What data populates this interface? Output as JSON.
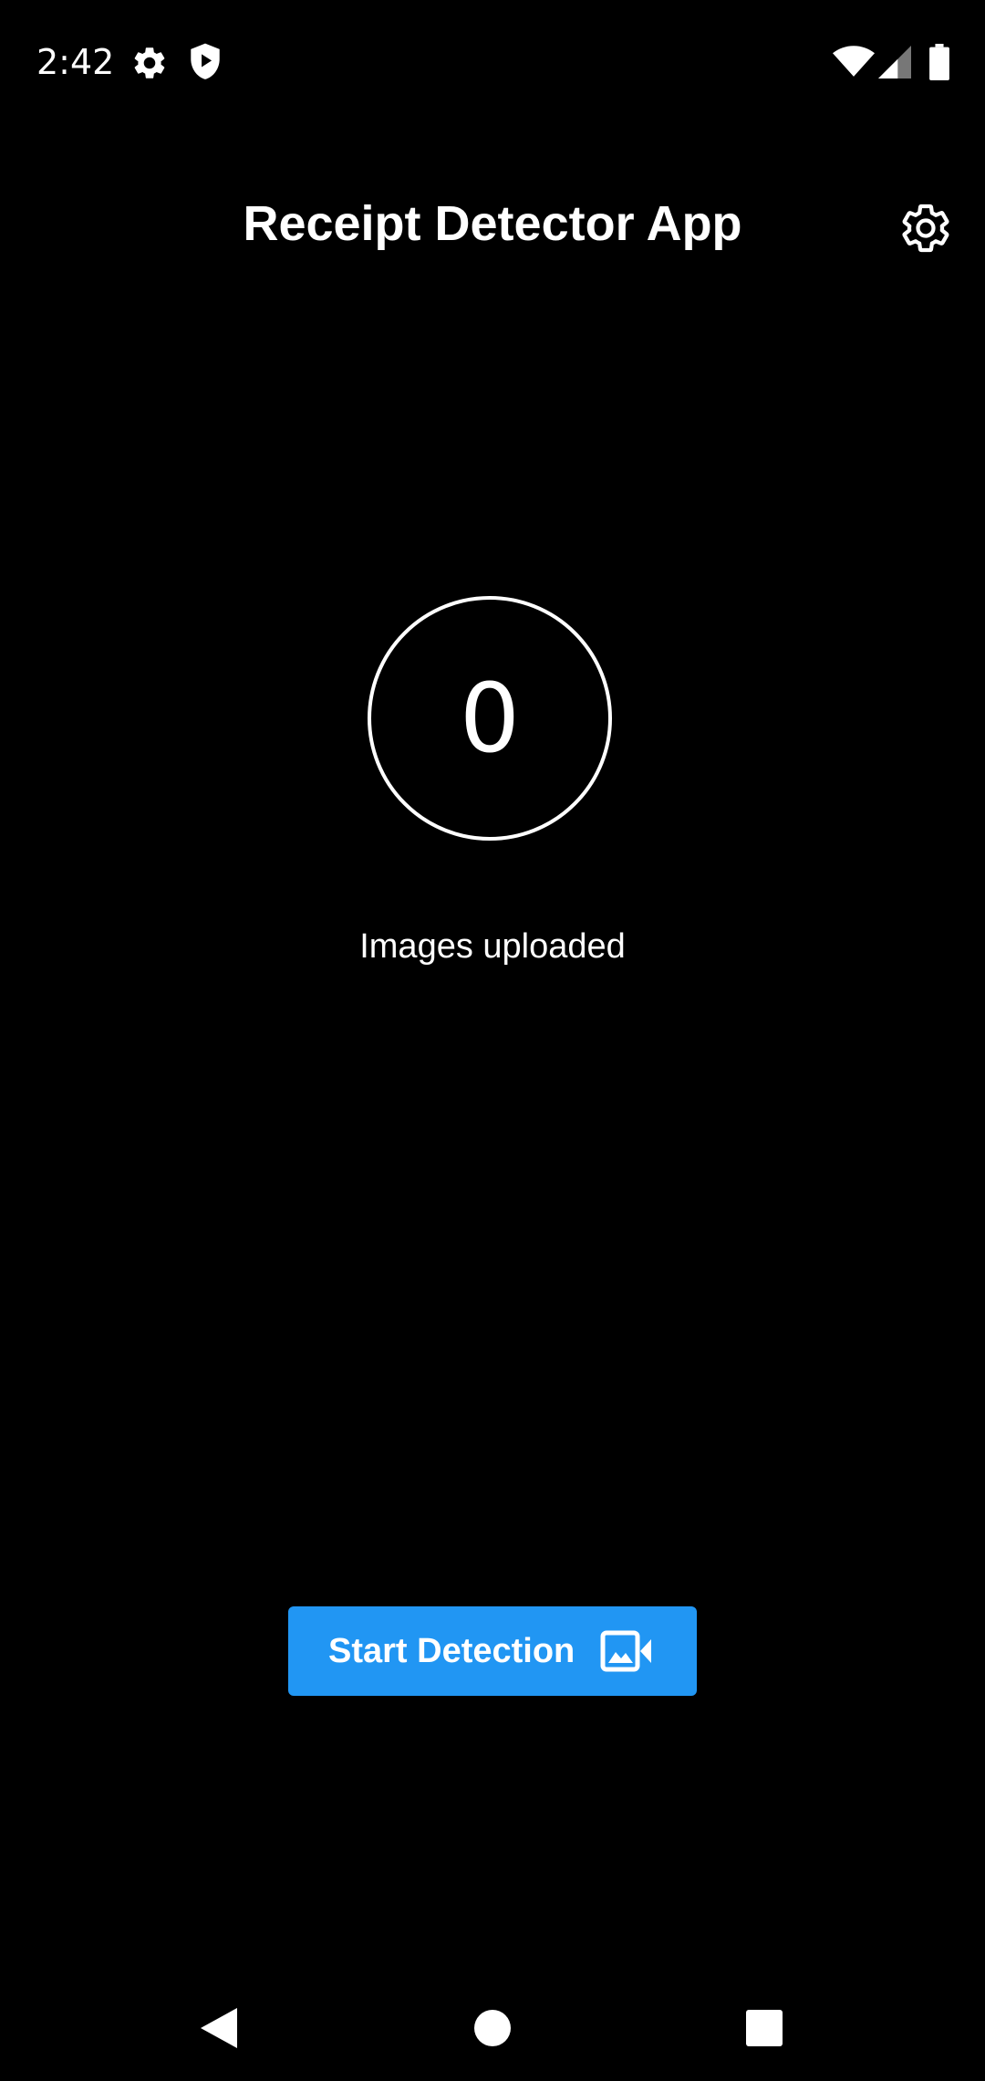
{
  "status_bar": {
    "time": "2:42",
    "icons": [
      "settings-icon",
      "shield-play-icon",
      "wifi-icon",
      "signal-icon",
      "battery-icon"
    ]
  },
  "app_bar": {
    "title": "Receipt Detector App",
    "settings_icon": "gear-icon"
  },
  "counter": {
    "value": "0",
    "label": "Images uploaded"
  },
  "start_button": {
    "label": "Start Detection",
    "icon": "video-image-icon",
    "color": "#2196f3"
  },
  "nav_bar": {
    "buttons": [
      "back-icon",
      "home-icon",
      "recents-icon"
    ]
  },
  "colors": {
    "background": "#000000",
    "text": "#ffffff",
    "accent": "#2196f3"
  }
}
